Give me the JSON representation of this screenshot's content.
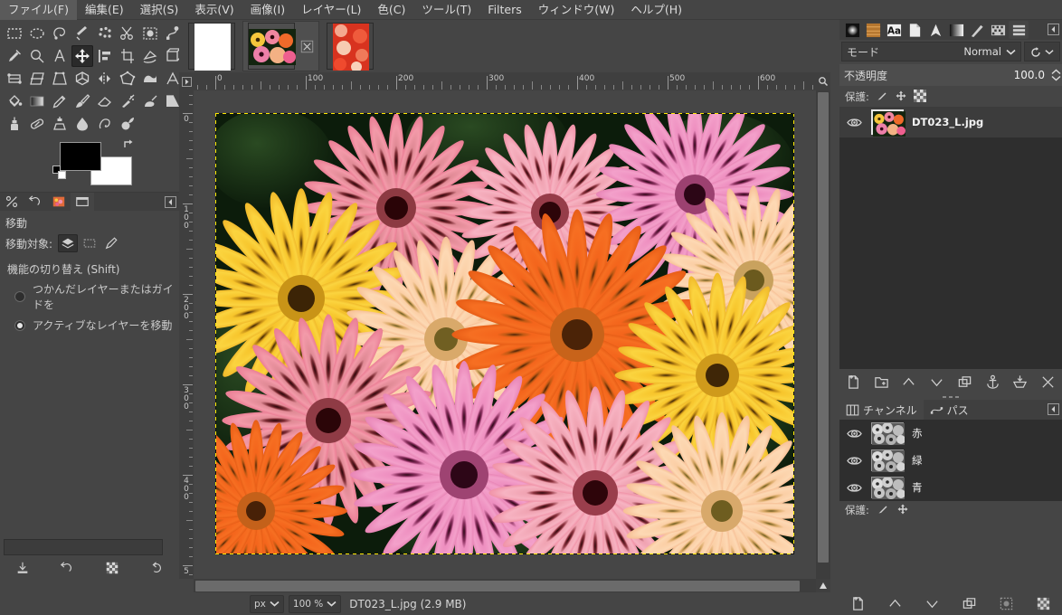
{
  "menubar": {
    "items": [
      {
        "label": "ファイル(F)",
        "name": "menu-file"
      },
      {
        "label": "編集(E)",
        "name": "menu-edit"
      },
      {
        "label": "選択(S)",
        "name": "menu-select"
      },
      {
        "label": "表示(V)",
        "name": "menu-view"
      },
      {
        "label": "画像(I)",
        "name": "menu-image"
      },
      {
        "label": "レイヤー(L)",
        "name": "menu-layer"
      },
      {
        "label": "色(C)",
        "name": "menu-colors"
      },
      {
        "label": "ツール(T)",
        "name": "menu-tools"
      },
      {
        "label": "Filters",
        "name": "menu-filters"
      },
      {
        "label": "ウィンドウ(W)",
        "name": "menu-windows"
      },
      {
        "label": "ヘルプ(H)",
        "name": "menu-help"
      }
    ]
  },
  "toolbox": {
    "tools": [
      "rect-select-icon",
      "ellipse-select-icon",
      "free-select-icon",
      "fuzzy-select-icon",
      "select-by-color-icon",
      "scissors-select-icon",
      "foreground-select-icon",
      "paths-icon",
      "color-picker-icon",
      "zoom-icon",
      "measure-icon",
      "move-icon",
      "alignment-icon",
      "crop-icon",
      "rotate-icon",
      "unified-transform-icon",
      "handle-transform-icon",
      "shear-icon",
      "perspective-icon",
      "3d-transform-icon",
      "flip-icon",
      "cage-transform-icon",
      "warp-transform-icon",
      "text-icon",
      "bucket-fill-icon",
      "gradient-icon",
      "pencil-icon",
      "paintbrush-icon",
      "eraser-icon",
      "airbrush-icon",
      "ink-icon",
      "mypaint-brush-icon",
      "clone-icon",
      "heal-icon",
      "perspective-clone-icon",
      "blur-sharpen-icon",
      "smudge-icon",
      "dodge-burn-icon"
    ],
    "active_tool": "move-icon",
    "foreground_color": "#000000",
    "background_color": "#ffffff"
  },
  "tool_options": {
    "tabs": [
      "device-status-icon",
      "undo-history-icon",
      "images-icon",
      "tool-options-icon"
    ],
    "active_tab": "tool-options-icon",
    "title": "移動",
    "move_target_label": "移動対象:",
    "move_targets": [
      "layer-mode-icon",
      "selection-mode-icon",
      "path-mode-icon"
    ],
    "active_move_target": "layer-mode-icon",
    "toggle_section_label": "機能の切り替え  (Shift)",
    "radios": [
      {
        "label": "つかんだレイヤーまたはガイドを",
        "selected": false
      },
      {
        "label": "アクティブなレイヤーを移動",
        "selected": true
      }
    ],
    "footer_buttons": [
      "save-tool-preset-icon",
      "restore-tool-preset-icon",
      "delete-tool-preset-icon",
      "reset-tool-options-icon"
    ]
  },
  "tabstrip": {
    "tabs": [
      {
        "name": "image-tab-blank",
        "kind": "blank",
        "active": false
      },
      {
        "name": "image-tab-flowers",
        "kind": "flowers",
        "active": true,
        "has_close": true
      },
      {
        "name": "image-tab-red-pattern",
        "kind": "redpattern",
        "active": false
      }
    ]
  },
  "canvas": {
    "h_ruler_labels": [
      "0",
      "100",
      "200",
      "300",
      "400",
      "500",
      "600"
    ],
    "v_ruler_labels": [
      "0",
      "100",
      "200",
      "300",
      "400",
      "5"
    ],
    "ruler_unit": "px",
    "selection_visible": true,
    "navigate_icon": "navigate-canvas-icon",
    "zoom_image_icon": "zoom-image-icon",
    "menu_arrow_icon": "image-menu-arrow-icon"
  },
  "statusbar": {
    "unit": "px",
    "zoom": "100 %",
    "status_text": "DT023_L.jpg (2.9 MB)"
  },
  "right_dock": {
    "tabs": [
      "brushes-icon",
      "patterns-icon",
      "fonts-icon",
      "document-history-icon",
      "pointer-icon",
      "gradients-icon",
      "paint-dynamics-icon",
      "palettes-icon",
      "layers-icon"
    ],
    "active_tab": "layers-icon",
    "menu_button": "dock-menu-icon",
    "mode_label": "モード",
    "mode_value": "Normal",
    "mode_revert_icon": "revert-mode-icon",
    "opacity_label": "不透明度",
    "opacity_value": "100.0",
    "lock_label": "保護:",
    "lock_icons": [
      "lock-pixels-icon",
      "lock-position-icon",
      "lock-alpha-icon"
    ],
    "layers": [
      {
        "name": "DT023_L.jpg",
        "visible": true,
        "selected": true
      }
    ],
    "layer_buttons": [
      "new-layer-icon",
      "new-layer-group-icon",
      "raise-layer-icon",
      "lower-layer-icon",
      "duplicate-layer-icon",
      "anchor-layer-icon",
      "merge-down-icon",
      "delete-layer-icon"
    ],
    "channel_tabs": [
      {
        "label": "チャンネル",
        "icon": "channels-icon",
        "active": true
      },
      {
        "label": "パス",
        "icon": "paths-tab-icon",
        "active": false
      }
    ],
    "channels": [
      {
        "label": "赤",
        "visible": true
      },
      {
        "label": "緑",
        "visible": true
      },
      {
        "label": "青",
        "visible": true
      }
    ],
    "channel_lock_label": "保護:",
    "channel_lock_icons": [
      "lock-pixels-icon",
      "lock-position-icon"
    ],
    "channel_buttons": [
      "new-channel-icon",
      "raise-channel-icon",
      "lower-channel-icon",
      "duplicate-channel-icon",
      "channel-to-selection-icon",
      "delete-channel-icon"
    ]
  },
  "colors": {
    "bg_dark": "#454545",
    "panel_dark": "#2e2e2e",
    "selection_yellow": "#ffe800"
  }
}
